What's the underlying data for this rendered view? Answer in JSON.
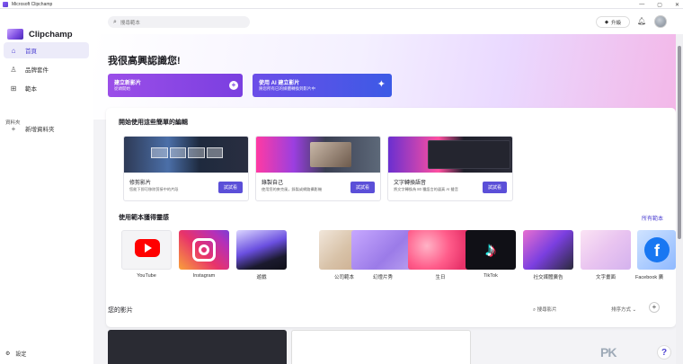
{
  "window": {
    "title": "Microsoft Clipchamp",
    "controls": [
      "—",
      "▢",
      "✕"
    ]
  },
  "sidebar": {
    "brand": "Clipchamp",
    "items": [
      {
        "label": "首頁",
        "icon": "home-icon",
        "active": true
      },
      {
        "label": "品牌套件",
        "icon": "brand-kit-icon",
        "active": false
      },
      {
        "label": "範本",
        "icon": "templates-icon",
        "active": false
      }
    ],
    "section_label": "資料夾",
    "new_folder": "新增資料夾",
    "settings": "設定"
  },
  "topbar": {
    "search_placeholder": "搜尋範本",
    "upgrade": "升級"
  },
  "hero": {
    "greeting": "我很高興認識您!",
    "card_new": {
      "title": "建立新影片",
      "subtitle": "從頭開始"
    },
    "card_ai": {
      "title": "使用 AI 建立影片",
      "subtitle": "將您所有已的媒體轉換到影片中"
    }
  },
  "tutorials": {
    "heading": "開始使用這些簡單的編輯",
    "cards": [
      {
        "title": "修剪影片",
        "desc": "您能下即可移除剪接中的片段",
        "button": "試試看"
      },
      {
        "title": "錄製自己",
        "desc": "使用您的麥克風，錄製或網路攝影機",
        "button": "試試看"
      },
      {
        "title": "文字轉換語音",
        "desc": "將文字轉換為 80 種語言的逼真 AI 聲音",
        "button": "試試看"
      }
    ]
  },
  "templates": {
    "heading": "使用範本獲得靈感",
    "all_link": "所有範本",
    "items": [
      {
        "label": "YouTube"
      },
      {
        "label": "Instagram"
      },
      {
        "label": "遊戲"
      },
      {
        "label": "公司範本"
      },
      {
        "label": "幻燈片秀"
      },
      {
        "label": "生日"
      },
      {
        "label": "TikTok"
      },
      {
        "label": "社交媒體廣告"
      },
      {
        "label": "文字畫面"
      },
      {
        "label": "Facebook 廣"
      }
    ]
  },
  "videos": {
    "heading": "您的影片",
    "search": "搜尋影片",
    "sort": "排序方式"
  },
  "watermark": "PK"
}
